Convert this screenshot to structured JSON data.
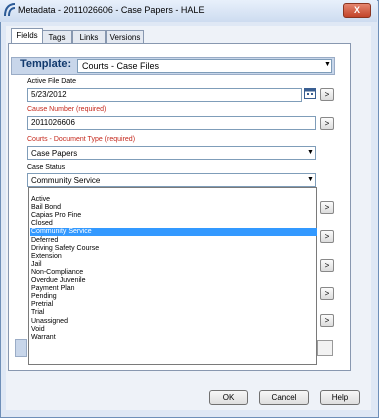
{
  "window": {
    "title": "Metadata - 2011026606 - Case Papers - HALE",
    "close_label": "X"
  },
  "tabs": [
    {
      "label": "Fields",
      "active": true
    },
    {
      "label": "Tags",
      "active": false
    },
    {
      "label": "Links",
      "active": false
    },
    {
      "label": "Versions",
      "active": false
    }
  ],
  "template": {
    "label": "Template:",
    "value": "Courts - Case Files"
  },
  "fields": {
    "active_file_date": {
      "label": "Active File Date",
      "value": "5/23/2012"
    },
    "cause_number": {
      "label": "Cause Number (required)",
      "value": "2011026606"
    },
    "document_type": {
      "label": "Courts - Document Type (required)",
      "value": "Case Papers"
    },
    "case_status": {
      "label": "Case Status",
      "value": "Community Service"
    }
  },
  "side_button_label": ">",
  "case_status_options": [
    "Active",
    "Bail Bond",
    "Capias Pro Fine",
    "Closed",
    "Community Service",
    "Deferred",
    "Driving Safety Course",
    "Extension",
    "Jail",
    "Non-Compliance",
    "Overdue Juvenile",
    "Payment Plan",
    "Pending",
    "Pretrial",
    "Trial",
    "Unassigned",
    "Void",
    "Warrant"
  ],
  "selected_option": "Community Service",
  "footer": {
    "ok": "OK",
    "cancel": "Cancel",
    "help": "Help"
  },
  "colors": {
    "selection": "#3399ff",
    "required_label": "#c4281c",
    "template_bar": "#c8d6ea"
  }
}
